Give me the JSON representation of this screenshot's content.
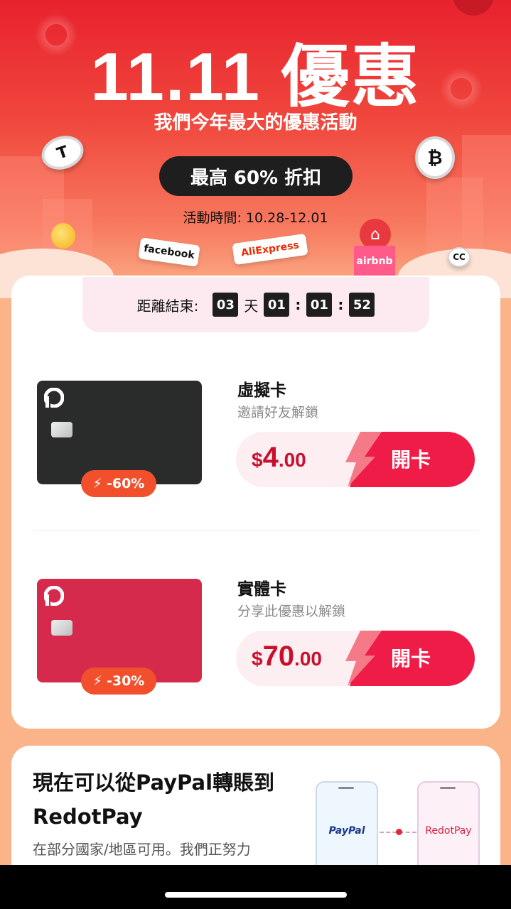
{
  "hero": {
    "title": "11.11 優惠",
    "subtitle": "我們今年最大的優惠活動",
    "pill": "最高 60% 折扣",
    "period": "活動時間: 10.28-12.01",
    "brands": {
      "facebook": "facebook",
      "aliexpress": "AliExpress",
      "airbnb": "airbnb",
      "chanel": "CC",
      "tether": "T",
      "bitcoin": "₿"
    }
  },
  "countdown": {
    "label": "距離結束:",
    "days": "03",
    "days_unit": "天",
    "hours": "01",
    "minutes": "01",
    "seconds": "52",
    "sep": ":"
  },
  "cards": [
    {
      "name": "虛擬卡",
      "desc": "邀請好友解鎖",
      "discount": "-60%",
      "currency": "$",
      "price_int": "4",
      "price_dec": ".00",
      "action": "開卡",
      "color": "#2a2c2b",
      "logo": "P"
    },
    {
      "name": "實體卡",
      "desc": "分享此優惠以解鎖",
      "discount": "-30%",
      "currency": "$",
      "price_int": "70",
      "price_dec": ".00",
      "action": "開卡",
      "color": "#d52a4b",
      "logo": "P"
    }
  ],
  "paypal": {
    "title": "現在可以從PayPal轉賬到RedotPay",
    "desc": "在部分國家/地區可用。我們正努力",
    "phone_left": "PayPal",
    "phone_right": "RedotPay"
  },
  "colors": {
    "brand_red": "#ee1c47",
    "discount_orange": "#f2502c"
  }
}
